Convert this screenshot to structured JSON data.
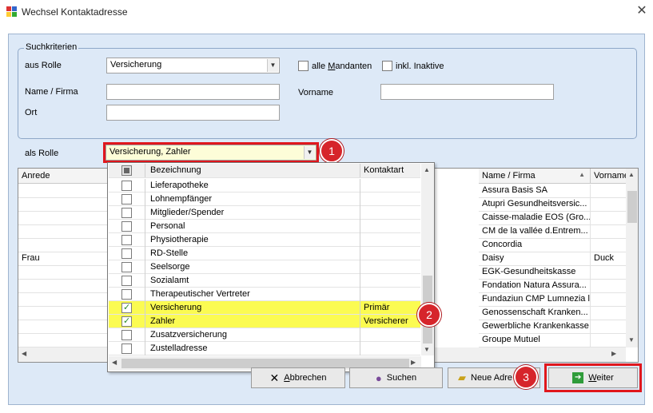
{
  "window": {
    "title": "Wechsel Kontaktadresse",
    "close_glyph": "✕"
  },
  "search": {
    "legend": "Suchkriterien",
    "role_label": "aus Rolle",
    "role_value": "Versicherung",
    "all_mandants_pre": "alle ",
    "all_mandants_ul": "M",
    "all_mandants_post": "andanten",
    "inactive_label": "inkl. Inaktive",
    "name_label": "Name / Firma",
    "firstname_label": "Vorname",
    "place_label": "Ort",
    "name_value": "",
    "firstname_value": "",
    "place_value": ""
  },
  "as_role": {
    "label": "als Rolle",
    "value": "Versicherung, Zahler"
  },
  "grid": {
    "headers": {
      "anrede": "Anrede",
      "name": "Name / Firma",
      "vorname": "Vorname"
    },
    "rows": [
      {
        "anrede": "",
        "name": "Assura Basis SA",
        "vorname": ""
      },
      {
        "anrede": "",
        "name": "Atupri Gesundheitsversic...",
        "vorname": ""
      },
      {
        "anrede": "",
        "name": "Caisse-maladie EOS (Gro...",
        "vorname": ""
      },
      {
        "anrede": "",
        "name": "CM de la vallée d.Entrem...",
        "vorname": ""
      },
      {
        "anrede": "",
        "name": "Concordia",
        "vorname": ""
      },
      {
        "anrede": "Frau",
        "name": "Daisy",
        "vorname": "Duck"
      },
      {
        "anrede": "",
        "name": "EGK-Gesundheitskasse",
        "vorname": ""
      },
      {
        "anrede": "",
        "name": "Fondation Natura Assura...",
        "vorname": ""
      },
      {
        "anrede": "",
        "name": "Fundaziun CMP Lumnezia l",
        "vorname": ""
      },
      {
        "anrede": "",
        "name": "Genossenschaft Kranken...",
        "vorname": ""
      },
      {
        "anrede": "",
        "name": "Gewerbliche Krankenkasse",
        "vorname": ""
      },
      {
        "anrede": "",
        "name": "Groupe Mutuel",
        "vorname": ""
      }
    ]
  },
  "dropdown": {
    "headers": {
      "name": "Bezeichnung",
      "type": "Kontaktart"
    },
    "items": [
      {
        "label": "Lieferapotheke",
        "type": "",
        "checked": false
      },
      {
        "label": "Lohnempfänger",
        "type": "",
        "checked": false
      },
      {
        "label": "Mitglieder/Spender",
        "type": "",
        "checked": false
      },
      {
        "label": "Personal",
        "type": "",
        "checked": false
      },
      {
        "label": "Physiotherapie",
        "type": "",
        "checked": false
      },
      {
        "label": "RD-Stelle",
        "type": "",
        "checked": false
      },
      {
        "label": "Seelsorge",
        "type": "",
        "checked": false
      },
      {
        "label": "Sozialamt",
        "type": "",
        "checked": false
      },
      {
        "label": "Therapeutischer Vertreter",
        "type": "",
        "checked": false
      },
      {
        "label": "Versicherung",
        "type": "Primär",
        "checked": true
      },
      {
        "label": "Zahler",
        "type": "Versicherer",
        "checked": true
      },
      {
        "label": "Zusatzversicherung",
        "type": "",
        "checked": false
      },
      {
        "label": "Zustelladresse",
        "type": "",
        "checked": false
      }
    ]
  },
  "buttons": {
    "cancel_ul": "A",
    "cancel_rest": "bbrechen",
    "search": "Suchen",
    "new_addr": "Neue Adre",
    "next_ul": "W",
    "next_rest": "eiter"
  },
  "badges": {
    "b1": "1",
    "b2": "2",
    "b3": "3"
  },
  "colors": {
    "highlight": "#fbfb52",
    "callout": "#e0171d"
  }
}
